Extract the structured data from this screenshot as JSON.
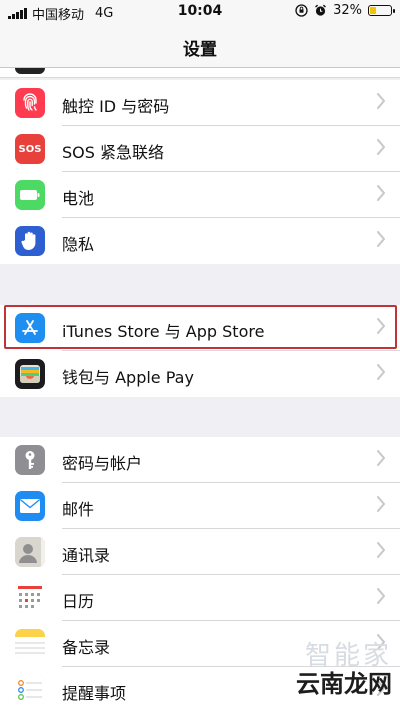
{
  "status_bar": {
    "carrier": "中国移动",
    "network": "4G",
    "time": "10:04",
    "battery": "32%",
    "battery_level": 0.32,
    "battery_color": "#f4c400"
  },
  "nav": {
    "title": "设置"
  },
  "groups": [
    {
      "items": [
        {
          "label": "触控 ID 与密码",
          "icon": "fingerprint-icon",
          "color": "#ff3b4f"
        },
        {
          "label": "SOS 紧急联络",
          "icon": "sos-icon",
          "icon_text": "SOS",
          "color": "#e8413b"
        },
        {
          "label": "电池",
          "icon": "battery-icon",
          "color": "#4cd964"
        },
        {
          "label": "隐私",
          "icon": "hand-icon",
          "color": "#2d5fd1"
        }
      ]
    },
    {
      "items": [
        {
          "label": "iTunes Store 与 App Store",
          "icon": "app-store-icon",
          "color": "#1f8ef1"
        },
        {
          "label": "钱包与 Apple Pay",
          "icon": "wallet-icon",
          "color": "#1c1c1e"
        }
      ]
    },
    {
      "items": [
        {
          "label": "密码与帐户",
          "icon": "key-icon",
          "color": "#8e8e93"
        },
        {
          "label": "邮件",
          "icon": "mail-icon",
          "color": "#1e8cf0"
        },
        {
          "label": "通讯录",
          "icon": "contacts-icon",
          "color": "#d9d6cf"
        },
        {
          "label": "日历",
          "icon": "calendar-icon",
          "color": "#ffffff"
        },
        {
          "label": "备忘录",
          "icon": "notes-icon",
          "color": "#ffffff"
        },
        {
          "label": "提醒事项",
          "icon": "reminders-icon",
          "color": "#ffffff"
        }
      ]
    }
  ],
  "watermark": {
    "top": "智能家",
    "bottom": "云南龙网"
  }
}
